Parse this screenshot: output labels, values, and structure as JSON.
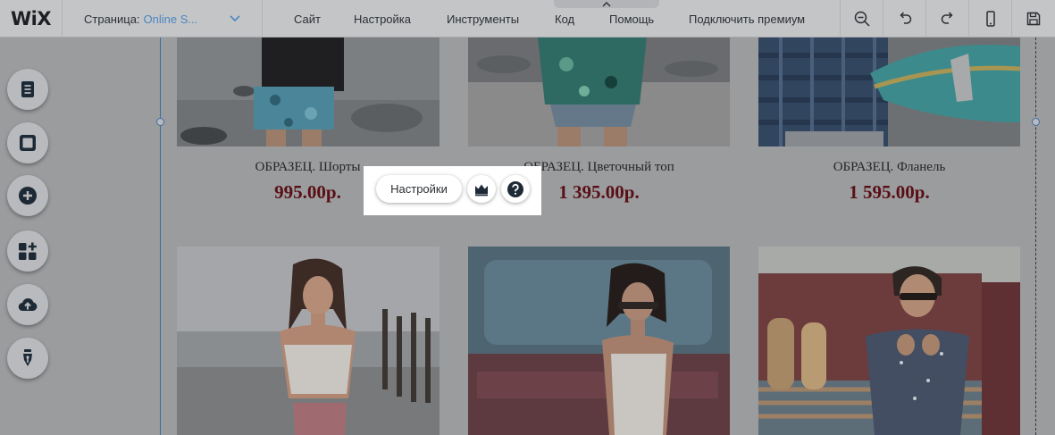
{
  "brand": {
    "logo_text": "WiX"
  },
  "page_selector": {
    "label": "Страница:",
    "value": "Online S..."
  },
  "menu": {
    "site": "Сайт",
    "settings": "Настройка",
    "tools": "Инструменты",
    "code": "Код",
    "help": "Помощь",
    "upgrade": "Подключить премиум"
  },
  "toolbar_icons": [
    "zoom-out-icon",
    "undo-icon",
    "redo-icon",
    "mobile-icon",
    "save-icon"
  ],
  "left_rail": [
    "pages-icon",
    "background-icon",
    "add-icon",
    "apps-icon",
    "upload-icon",
    "blog-pen-icon"
  ],
  "products": [
    {
      "name": "ОБРАЗЕЦ. Шорты",
      "price": "995.00р."
    },
    {
      "name": "ОБРАЗЕЦ. Цветочный топ",
      "price": "1 395.00р."
    },
    {
      "name": "ОБРАЗЕЦ. Фланель",
      "price": "1 595.00р."
    }
  ],
  "gfpp": {
    "settings_label": "Настройки",
    "icons": [
      "crown-icon",
      "help-icon"
    ]
  },
  "colors": {
    "accent_link": "#4a86c0",
    "price": "#5a0f16",
    "guide": "#3e6ea5"
  }
}
